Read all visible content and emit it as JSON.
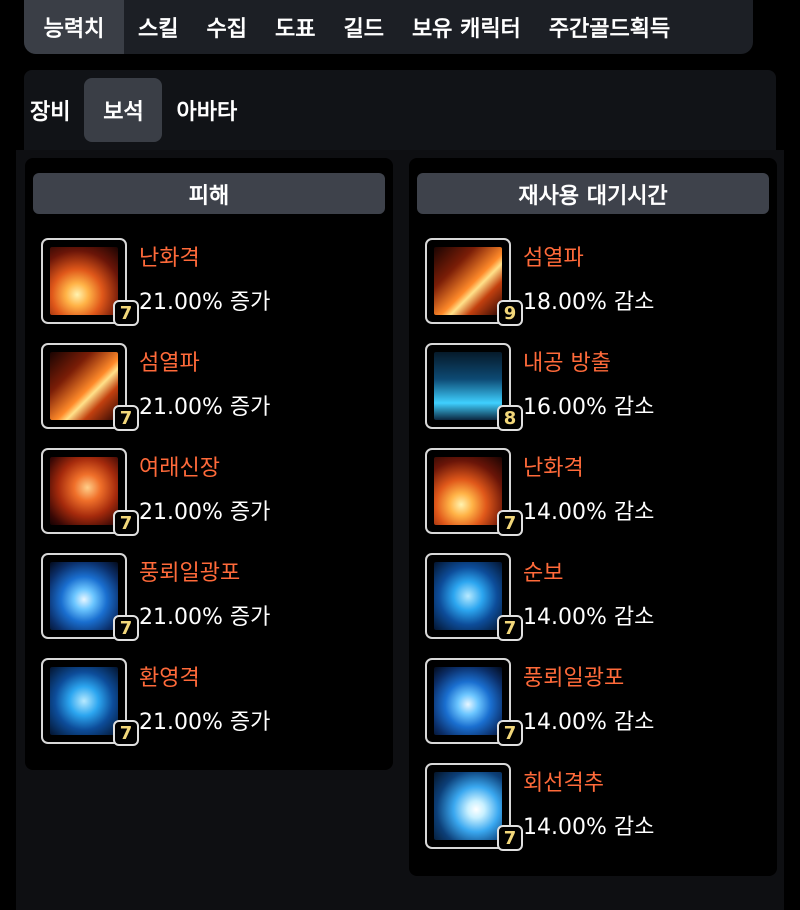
{
  "topnav": {
    "tabs": [
      "능력치",
      "스킬",
      "수집",
      "도표",
      "길드",
      "보유 캐릭터",
      "주간골드획득"
    ],
    "active_index": 0
  },
  "subtabs": {
    "tabs": [
      "장비",
      "보석",
      "아바타"
    ],
    "active_index": 1
  },
  "damage": {
    "header": "피해",
    "gems": [
      {
        "name": "난화격",
        "effect": "21.00% 증가",
        "level": "7",
        "icon": "fire-slash-icon"
      },
      {
        "name": "섬열파",
        "effect": "21.00% 증가",
        "level": "7",
        "icon": "fire-wave-icon"
      },
      {
        "name": "여래신장",
        "effect": "21.00% 증가",
        "level": "7",
        "icon": "fire-palm-icon"
      },
      {
        "name": "풍뢰일광포",
        "effect": "21.00% 증가",
        "level": "7",
        "icon": "blue-wind-icon"
      },
      {
        "name": "환영격",
        "effect": "21.00% 증가",
        "level": "7",
        "icon": "phantom-strike-icon"
      }
    ]
  },
  "cooldown": {
    "header": "재사용 대기시간",
    "gems": [
      {
        "name": "섬열파",
        "effect": "18.00% 감소",
        "level": "9",
        "icon": "fire-wave-icon"
      },
      {
        "name": "내공 방출",
        "effect": "16.00% 감소",
        "level": "8",
        "icon": "energy-release-icon"
      },
      {
        "name": "난화격",
        "effect": "14.00% 감소",
        "level": "7",
        "icon": "fire-slash-icon"
      },
      {
        "name": "순보",
        "effect": "14.00% 감소",
        "level": "7",
        "icon": "dash-step-icon"
      },
      {
        "name": "풍뢰일광포",
        "effect": "14.00% 감소",
        "level": "7",
        "icon": "blue-wind-icon"
      },
      {
        "name": "회선격추",
        "effect": "14.00% 감소",
        "level": "7",
        "icon": "spiral-burst-icon"
      }
    ]
  },
  "colors": {
    "skill_name": "#ff6a3a",
    "gem_level": "#f2d77a",
    "header_bg": "#3e424b",
    "active_tab_bg": "#3a3e46"
  }
}
